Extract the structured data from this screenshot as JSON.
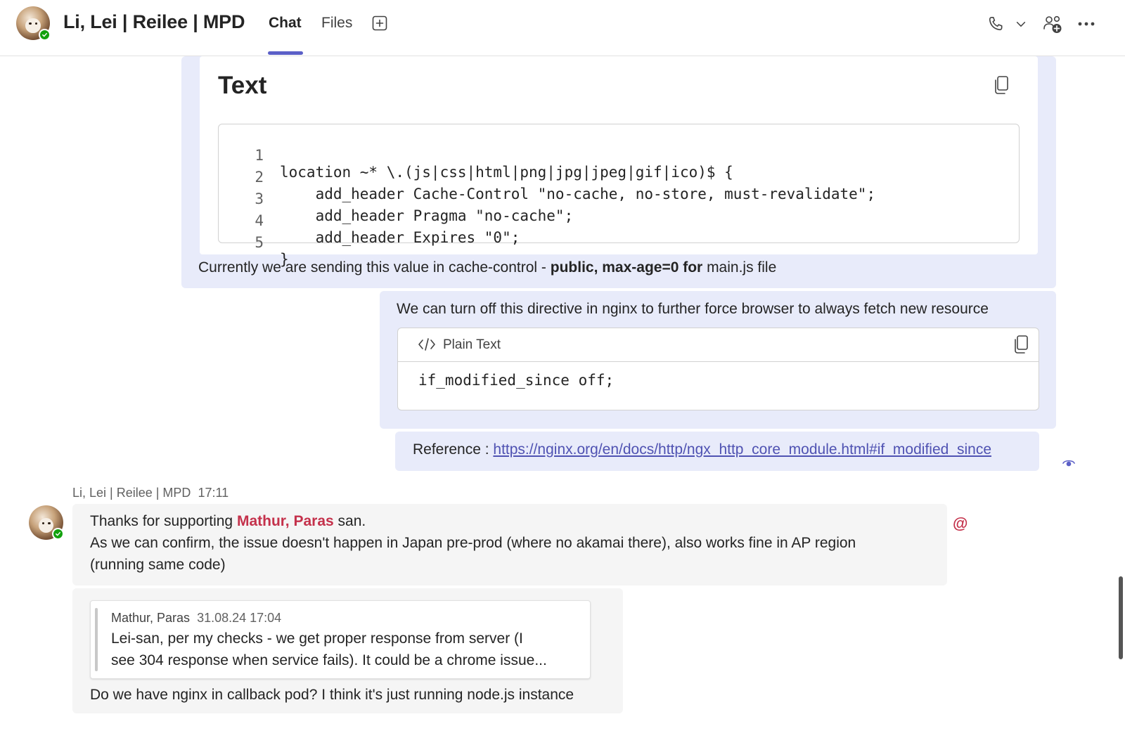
{
  "header": {
    "title": "Li, Lei | Reilee | MPD",
    "tabs": [
      {
        "label": "Chat",
        "active": true
      },
      {
        "label": "Files",
        "active": false
      }
    ],
    "icons": [
      "add-tab-icon",
      "phone-icon",
      "chevron-down-icon",
      "add-people-icon",
      "more-options-icon"
    ],
    "accent": "#5b5fc7"
  },
  "messages": {
    "code_card": {
      "title": "Text",
      "lines": [
        {
          "n": "1",
          "code": "location ~* \\.(js|css|html|png|jpg|jpeg|gif|ico)$ {"
        },
        {
          "n": "2",
          "code": "    add_header Cache-Control \"no-cache, no-store, must-revalidate\";"
        },
        {
          "n": "3",
          "code": "    add_header Pragma \"no-cache\";"
        },
        {
          "n": "4",
          "code": "    add_header Expires \"0\";"
        },
        {
          "n": "5",
          "code": "}"
        }
      ],
      "caption_prefix": "Currently we are sending this value in cache-control - ",
      "caption_bold": "public, max-age=0 for",
      "caption_suffix": " main.js file"
    },
    "directive_msg": {
      "text": "We can turn off this directive in nginx to further force browser to always fetch new resource",
      "code_label": "Plain Text",
      "code": "if_modified_since off;"
    },
    "reference_msg": {
      "prefix": "Reference : ",
      "link": "https://nginx.org/en/docs/http/ngx_http_core_module.html#if_modified_since"
    },
    "reply": {
      "author": "Li, Lei | Reilee | MPD",
      "time": "17:11",
      "line1_prefix": "Thanks for supporting ",
      "mention": "Mathur, Paras",
      "line1_suffix": " san.",
      "line2": "As we can confirm, the issue doesn't happen in Japan pre-prod (where no akamai there), also works fine in AP region",
      "line3": "(running same code)",
      "mention_icon": "@"
    },
    "quoted": {
      "author": "Mathur, Paras",
      "time": "31.08.24 17:04",
      "line1": "Lei-san, per my checks - we get proper response from server (I",
      "line2": "see 304 response when service fails). It could be a chrome issue...",
      "followup": "Do we have nginx in callback pod? I think it's just running node.js instance"
    }
  },
  "colors": {
    "own_bubble": "#e8ebfa",
    "other_bubble": "#f5f5f5",
    "mention": "#c4314b",
    "link": "#4f52b2",
    "presence": "#13a10e"
  }
}
